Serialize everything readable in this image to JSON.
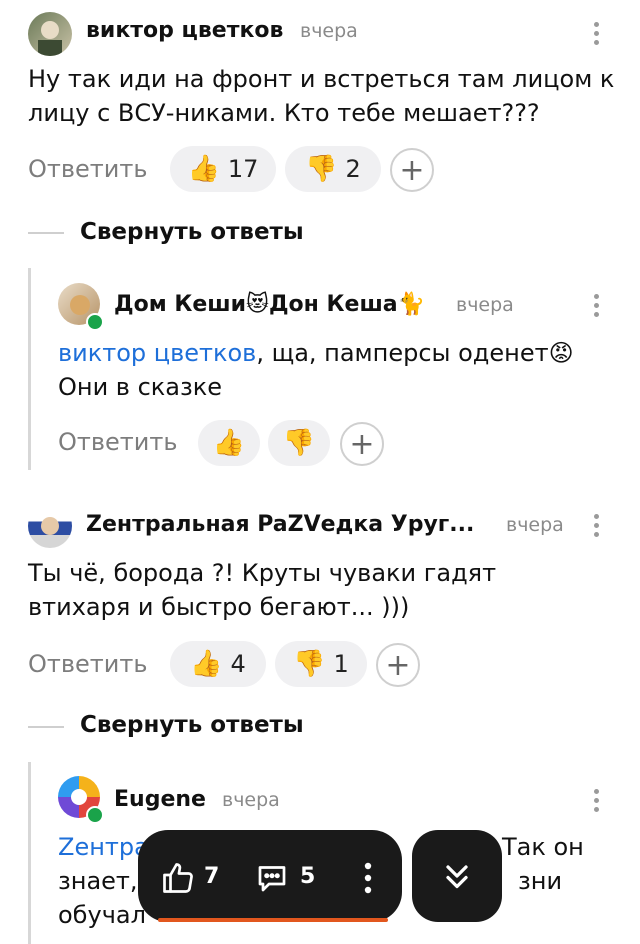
{
  "comment1": {
    "author": "виктор цветков",
    "time": "вчера",
    "text": "Ну так иди на фронт и встреться там лицом к лицу с ВСУ-никами. Кто тебе мешает???",
    "reply": "Ответить",
    "likes": "17",
    "dislikes": "2"
  },
  "collapse1": "Свернуть ответы",
  "reply1": {
    "author": "Дом Кеши😻Дон Кеша🐈",
    "time": "вчера",
    "mention": "виктор цветков",
    "text": ", ща, памперсы оденет😡 Они в сказке",
    "reply": "Ответить"
  },
  "comment2": {
    "author": "Zентральная PaZVедка Уруг...",
    "time": "вчера",
    "text": "Ты чё, борода ?! Круты чуваки гадят втихаря и быстро бегают... )))",
    "reply": "Ответить",
    "likes": "4",
    "dislikes": "1"
  },
  "collapse2": "Свернуть ответы",
  "reply2": {
    "author": "Eugene",
    "time": "вчера",
    "mention_start": "Zентра",
    "text_right1": "Так он",
    "line2_left": "знает,",
    "line2_right": "зни",
    "line3_left": "обучал"
  },
  "bottom_bar": {
    "likes": "7",
    "comments": "5"
  },
  "colors": {
    "accent_link": "#1e6fd9",
    "online": "#1aa34a",
    "bar": "#1a1a1a"
  }
}
